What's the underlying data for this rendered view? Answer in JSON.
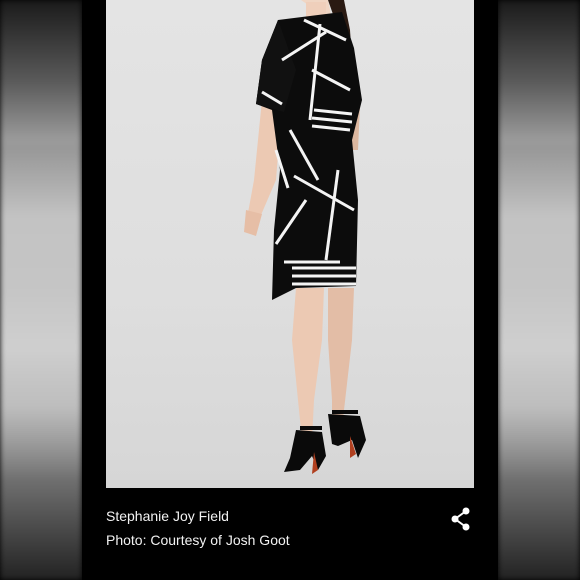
{
  "caption": {
    "name": "Stephanie Joy Field",
    "credit": "Photo: Courtesy of Josh Goot"
  },
  "share": {
    "icon": "share-icon"
  },
  "colors": {
    "background": "#000000",
    "photo_backdrop": "#e0e0e0",
    "caption_text": "#f2f2f2"
  }
}
